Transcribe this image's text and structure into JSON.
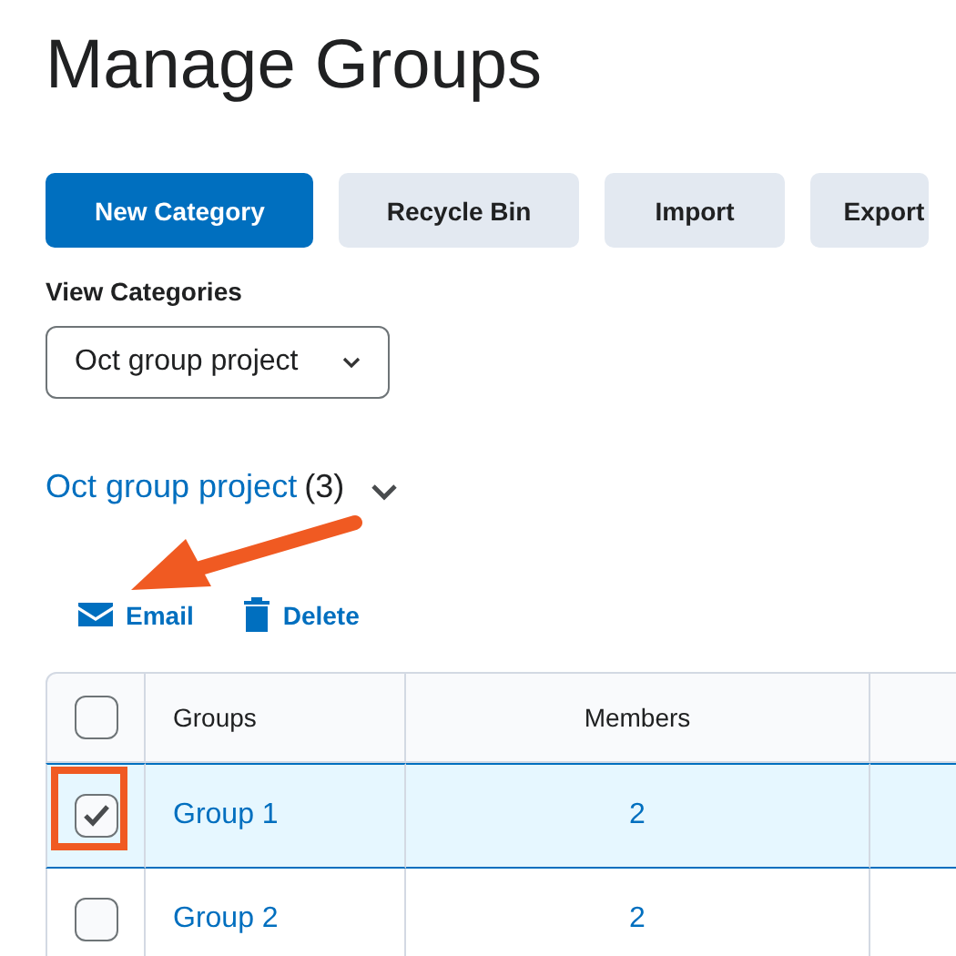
{
  "page": {
    "title": "Manage Groups"
  },
  "buttons": [
    {
      "label": "New Category",
      "kind": "primary"
    },
    {
      "label": "Recycle Bin",
      "kind": "secondary"
    },
    {
      "label": "Import",
      "kind": "secondary"
    },
    {
      "label": "Export",
      "kind": "secondary"
    }
  ],
  "view_categories": {
    "label": "View Categories",
    "value": "Oct group project"
  },
  "category": {
    "name": "Oct group project",
    "count": "(3)"
  },
  "actions": [
    {
      "label": "Email",
      "kind": "email"
    },
    {
      "label": "Delete",
      "kind": "delete"
    }
  ],
  "table": {
    "select_all_checked": false,
    "columns": [
      "Groups",
      "Members"
    ],
    "rows": [
      {
        "name": "Group 1",
        "members": "2",
        "checked": true,
        "selected": true
      },
      {
        "name": "Group 2",
        "members": "2",
        "checked": false,
        "selected": false
      }
    ]
  }
}
